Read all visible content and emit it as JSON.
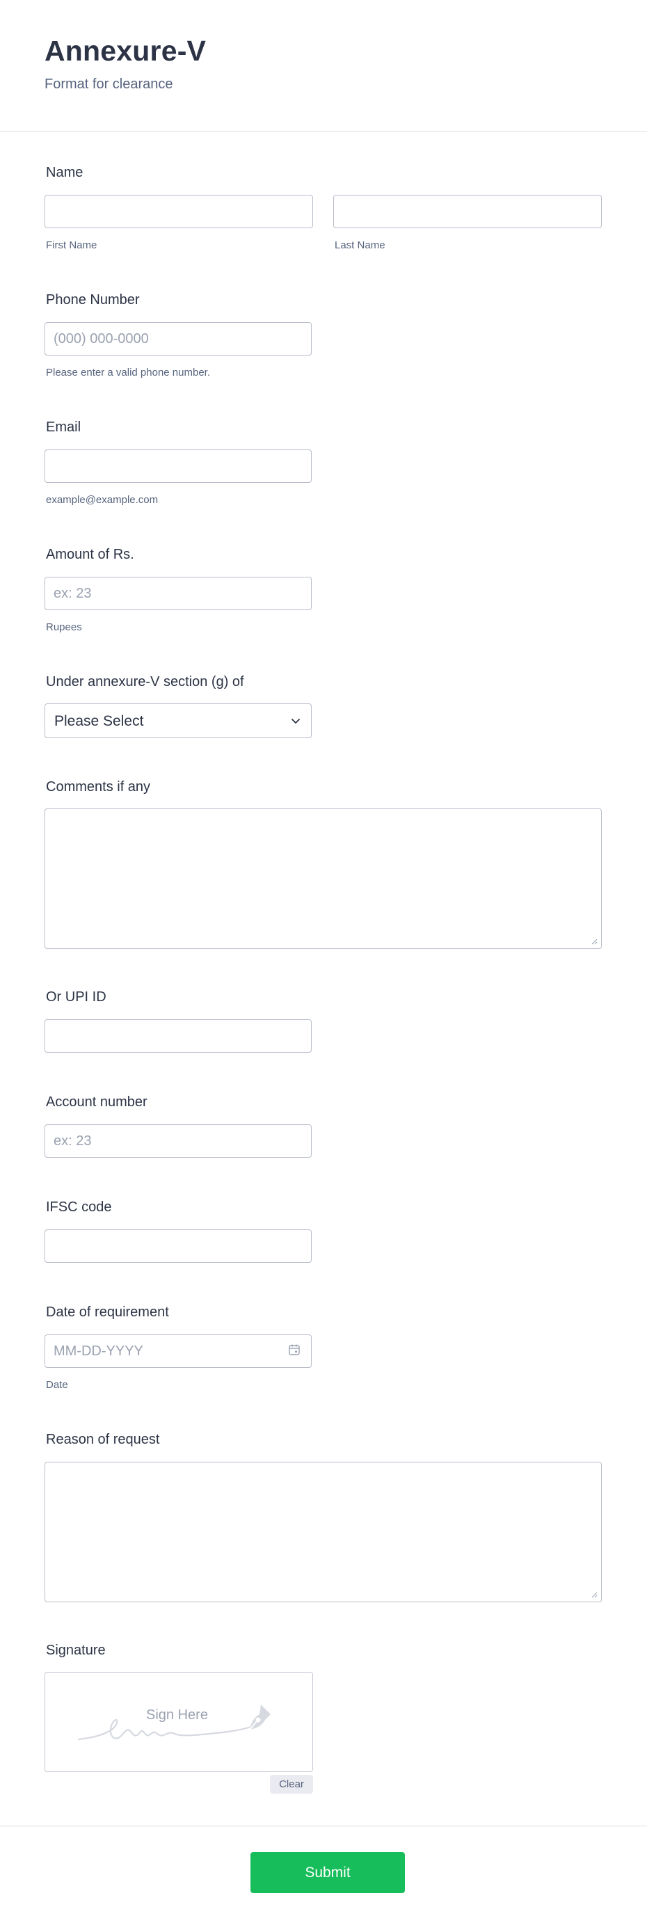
{
  "header": {
    "title": "Annexure-V",
    "subtitle": "Format for clearance"
  },
  "fields": {
    "name": {
      "label": "Name",
      "first_sublabel": "First Name",
      "last_sublabel": "Last Name"
    },
    "phone": {
      "label": "Phone Number",
      "placeholder": "(000) 000-0000",
      "sublabel": "Please enter a valid phone number."
    },
    "email": {
      "label": "Email",
      "sublabel": "example@example.com"
    },
    "amount": {
      "label": "Amount of Rs.",
      "placeholder": "ex: 23",
      "sublabel": "Rupees"
    },
    "section": {
      "label": "Under annexure-V section (g) of",
      "selected": "Please Select"
    },
    "comments": {
      "label": "Comments if any"
    },
    "upi": {
      "label": "Or UPI ID"
    },
    "account": {
      "label": "Account number",
      "placeholder": "ex: 23"
    },
    "ifsc": {
      "label": "IFSC code"
    },
    "date": {
      "label": "Date of requirement",
      "placeholder": "MM-DD-YYYY",
      "sublabel": "Date"
    },
    "reason": {
      "label": "Reason of request"
    },
    "signature": {
      "label": "Signature",
      "placeholder": "Sign Here",
      "clear_label": "Clear"
    }
  },
  "footer": {
    "submit_label": "Submit"
  },
  "colors": {
    "accent_green": "#18bd5b",
    "text_dark": "#2c3345",
    "text_muted": "#57647e",
    "border": "#b8bdc9"
  },
  "icons": {
    "select_arrow": "chevron-down-icon",
    "date_picker": "calendar-icon",
    "signature_pen": "pen-nib-icon"
  }
}
